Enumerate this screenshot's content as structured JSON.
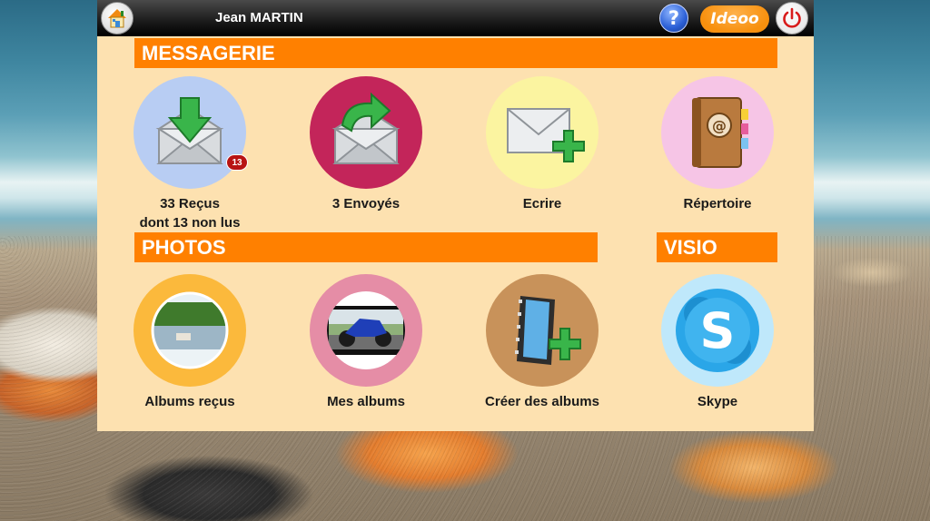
{
  "header": {
    "user_name": "Jean MARTIN",
    "help_label": "?",
    "brand_name": "Ideoo"
  },
  "messagerie": {
    "title": "MESSAGERIE",
    "tiles": [
      {
        "label_line1": "33 Reçus",
        "label_line2": "dont 13 non lus",
        "badge": "13",
        "icon": "inbox-envelope-icon",
        "color": "#b8cdf3"
      },
      {
        "label_line1": "3 Envoyés",
        "icon": "sent-envelope-icon",
        "color": "#c3255a"
      },
      {
        "label_line1": "Ecrire",
        "icon": "compose-envelope-icon",
        "color": "#fbf4a0"
      },
      {
        "label_line1": "Répertoire",
        "icon": "address-book-icon",
        "color": "#f6c5e6"
      }
    ]
  },
  "photos": {
    "title": "PHOTOS",
    "tiles": [
      {
        "label": "Albums reçus",
        "icon": "landscape-photo-icon",
        "color": "#fbb93c"
      },
      {
        "label": "Mes albums",
        "icon": "motorbike-photo-icon",
        "color": "#e58da6"
      },
      {
        "label": "Créer des albums",
        "icon": "film-add-icon",
        "color": "#c8925a"
      }
    ]
  },
  "visio": {
    "title": "VISIO",
    "tiles": [
      {
        "label": "Skype",
        "icon": "skype-icon",
        "color": "#bfe8fb"
      }
    ]
  },
  "colors": {
    "accent": "#ff8000",
    "panel": "#fde1b0",
    "topbar": "#000000"
  }
}
